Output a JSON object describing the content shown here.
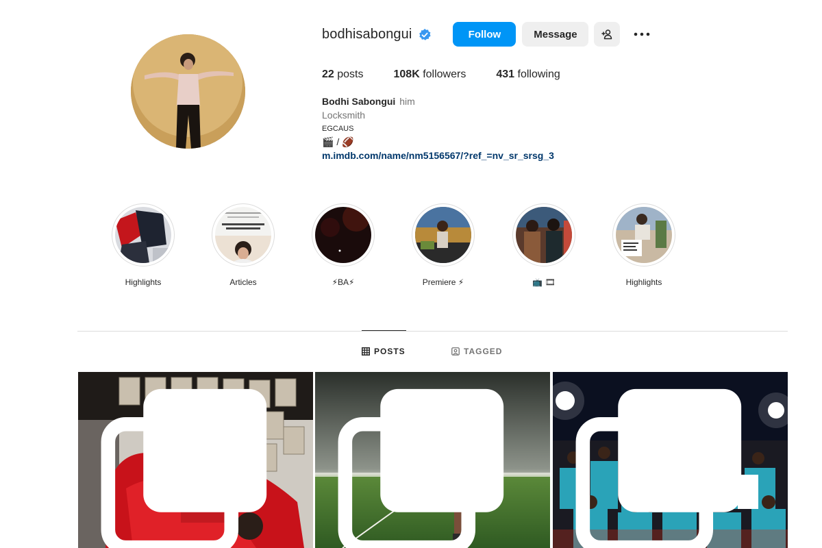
{
  "profile": {
    "username": "bodhisabongui",
    "verified": true,
    "buttons": {
      "follow": "Follow",
      "message": "Message"
    },
    "stats": {
      "posts_count": "22",
      "posts_label": "posts",
      "followers_count": "108K",
      "followers_label": "followers",
      "following_count": "431",
      "following_label": "following"
    },
    "bio": {
      "full_name": "Bodhi Sabongui",
      "pronouns": "him",
      "category": "Locksmith",
      "line1": "EGCAUS",
      "line2": "🎬 / 🏈",
      "link": "m.imdb.com/name/nm5156567/?ref_=nv_sr_srsg_3"
    }
  },
  "highlights": [
    {
      "label": "Highlights"
    },
    {
      "label": "Articles"
    },
    {
      "label": "⚡BA⚡"
    },
    {
      "label": "Premiere ⚡"
    },
    {
      "label": "📺 🎞"
    },
    {
      "label": "Highlights"
    }
  ],
  "tabs": {
    "posts": "POSTS",
    "tagged": "TAGGED"
  },
  "colors": {
    "accent": "#0095f6",
    "link": "#00376b",
    "secondary_text": "#737373",
    "button_bg": "#efefef"
  },
  "icons": [
    "verified-badge-icon",
    "add-user-icon",
    "more-options-icon",
    "grid-icon",
    "tagged-icon",
    "multiple-posts-icon"
  ]
}
